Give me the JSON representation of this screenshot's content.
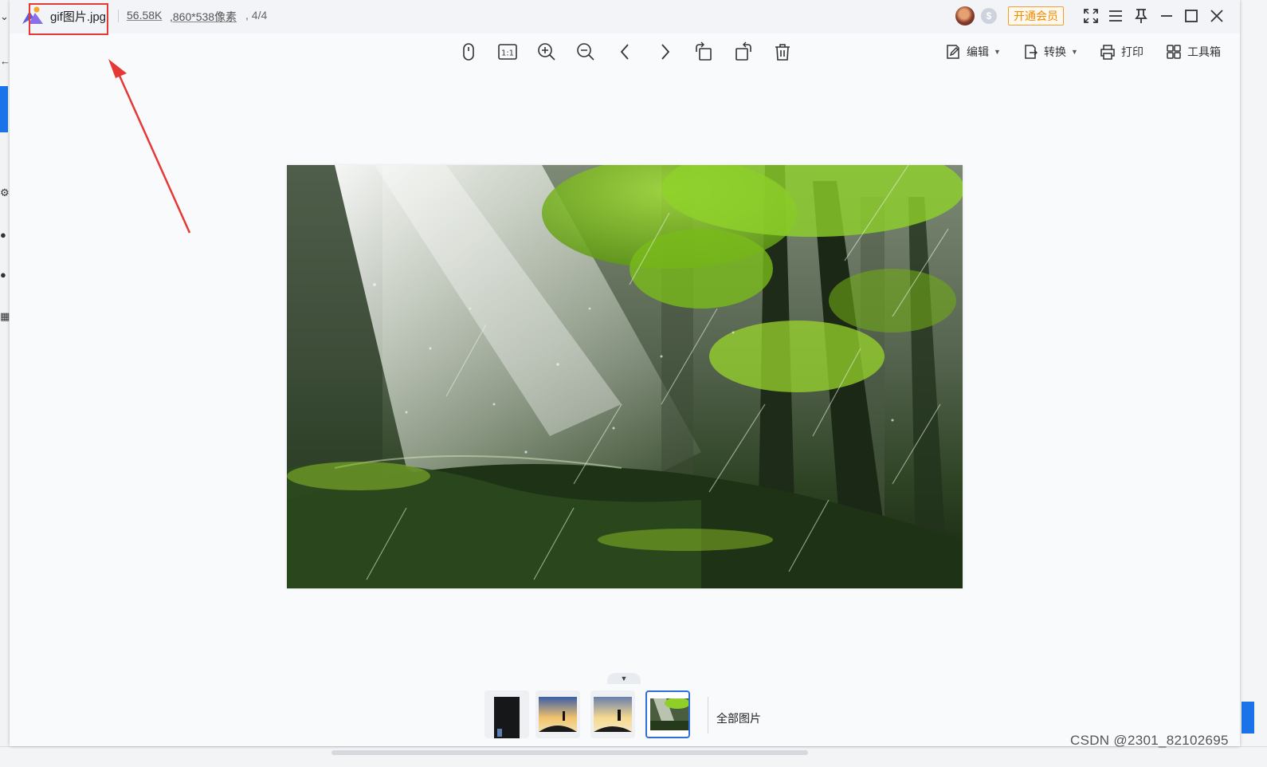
{
  "titlebar": {
    "file_name": "gif图片.jpg",
    "file_size": "56.58K",
    "file_dimensions": ",860*538像素",
    "file_position": ", 4/4",
    "vip_button": "开通会员",
    "coin_icon": "$"
  },
  "toolbar": {
    "icons": [
      "mouse-icon",
      "actual-size-icon",
      "zoom-in-icon",
      "zoom-out-icon",
      "previous-icon",
      "next-icon",
      "rotate-left-icon",
      "rotate-right-icon",
      "delete-icon"
    ],
    "actual_size_label": "1:1",
    "edit_label": "编辑",
    "convert_label": "转换",
    "print_label": "打印",
    "toolbox_label": "工具箱"
  },
  "thumbnails": {
    "toggle": "▼",
    "items": [
      "dark-poster",
      "hiker-sunset-1",
      "hiker-sunset-2",
      "forest-rain"
    ],
    "selected_index": 3,
    "all_images_label": "全部图片"
  },
  "watermark": "CSDN @2301_82102695",
  "colors": {
    "accent": "#2f6fdc",
    "vip": "#f08a00",
    "highlight": "#e53935",
    "forest_green": "#7fbf1e"
  }
}
